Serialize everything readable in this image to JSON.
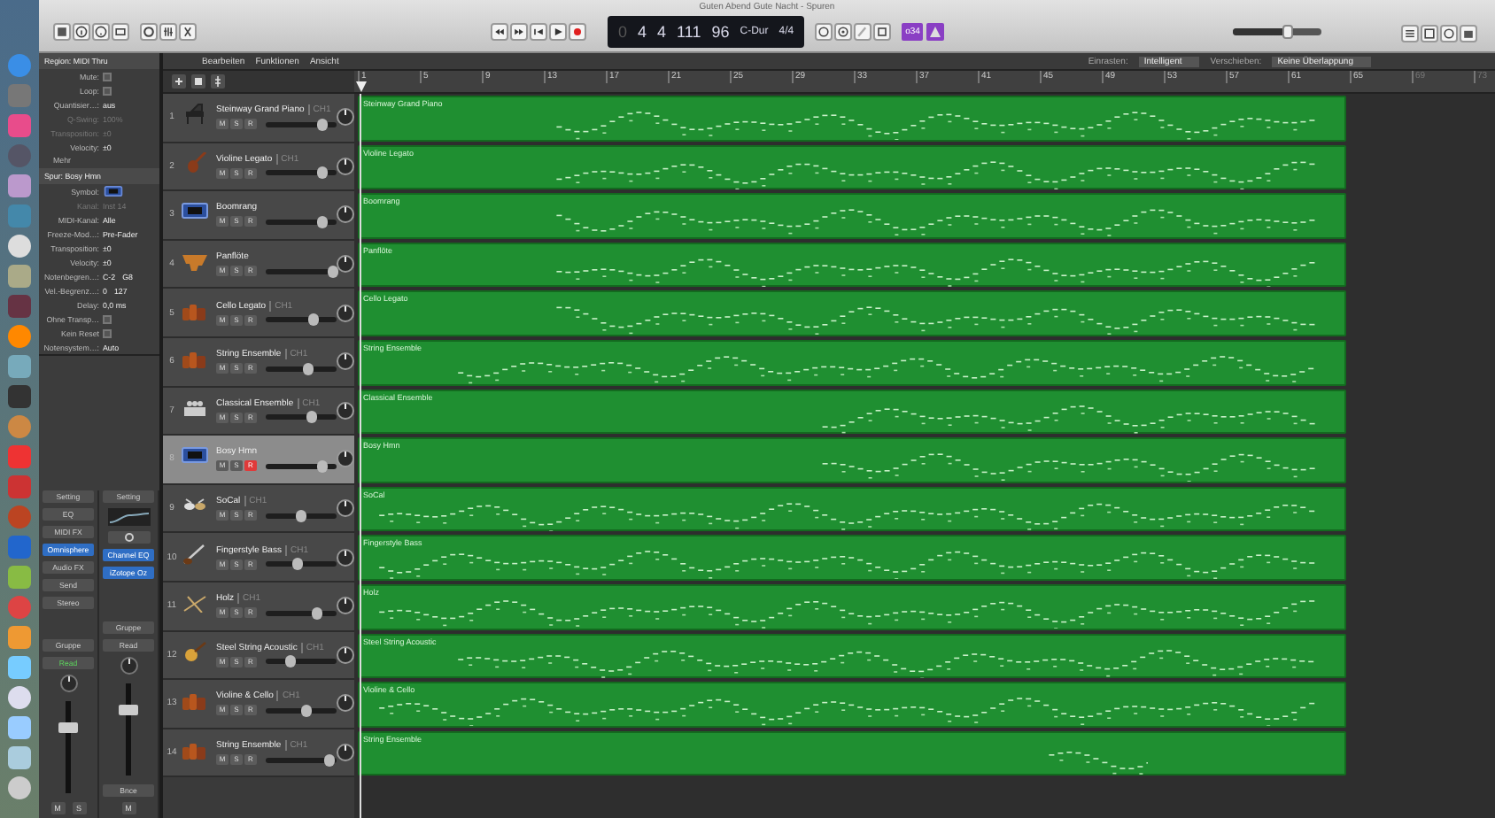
{
  "window": {
    "title": "Guten Abend Gute Nacht - Spuren"
  },
  "transport": {
    "lcd": [
      {
        "text": "0",
        "dim": true
      },
      {
        "text": "4",
        "dim": false
      },
      {
        "text": "4",
        "dim": false
      },
      {
        "text": "111",
        "dim": false
      },
      {
        "text": "96",
        "dim": false
      },
      {
        "text": "C-Dur",
        "dim": false
      },
      {
        "text": "4/4",
        "dim": false
      }
    ],
    "count_in": "o34",
    "master": {
      "level": 0.62
    }
  },
  "inspector": {
    "region": {
      "title": "Region: MIDI Thru",
      "params": [
        {
          "kind": "checkbox",
          "label": "Mute:",
          "checked": false
        },
        {
          "kind": "checkbox",
          "label": "Loop:",
          "checked": false
        },
        {
          "kind": "value",
          "label": "Quantisier…:",
          "values": [
            "aus"
          ],
          "disabled": false
        },
        {
          "kind": "value",
          "label": "Q-Swing:",
          "values": [
            "100%"
          ],
          "disabled": true
        },
        {
          "kind": "value",
          "label": "Transposition:",
          "values": [
            "±0"
          ],
          "disabled": true
        },
        {
          "kind": "value",
          "label": "Velocity:",
          "values": [
            "±0"
          ],
          "disabled": false
        },
        {
          "kind": "more",
          "label": "Mehr"
        }
      ]
    },
    "track": {
      "title": "Spur: Bosy Hmn",
      "params": [
        {
          "kind": "symbol",
          "label": "Symbol:"
        },
        {
          "kind": "value",
          "label": "Kanal:",
          "values": [
            "Inst 14"
          ],
          "disabled": true
        },
        {
          "kind": "value",
          "label": "MIDI-Kanal:",
          "values": [
            "Alle"
          ],
          "disabled": false
        },
        {
          "kind": "value",
          "label": "Freeze-Mod…:",
          "values": [
            "Pre-Fader"
          ],
          "disabled": false
        },
        {
          "kind": "value",
          "label": "Transposition:",
          "values": [
            "±0"
          ],
          "disabled": false
        },
        {
          "kind": "value",
          "label": "Velocity:",
          "values": [
            "±0"
          ],
          "disabled": false
        },
        {
          "kind": "value",
          "label": "Notenbegren…:",
          "values": [
            "C-2",
            "G8"
          ],
          "disabled": false
        },
        {
          "kind": "value",
          "label": "Vel.-Begrenz…:",
          "values": [
            "0",
            "127"
          ],
          "disabled": false
        },
        {
          "kind": "value",
          "label": "Delay:",
          "values": [
            "0,0 ms"
          ],
          "disabled": false
        },
        {
          "kind": "checkbox",
          "label": "Ohne Transp…",
          "checked": false
        },
        {
          "kind": "checkbox",
          "label": "Kein Reset",
          "checked": false
        },
        {
          "kind": "value",
          "label": "Notensystem…:",
          "values": [
            "Auto"
          ],
          "disabled": false
        }
      ]
    }
  },
  "channel_strips": [
    {
      "inserts": [
        {
          "kind": "button",
          "label": "Setting"
        },
        {
          "kind": "button",
          "label": "EQ"
        },
        {
          "kind": "button",
          "label": "MIDI FX"
        },
        {
          "kind": "plugin",
          "label": "Omnisphere"
        },
        {
          "kind": "button",
          "label": "Audio FX"
        },
        {
          "kind": "button",
          "label": "Send"
        },
        {
          "kind": "button",
          "label": "Stereo"
        }
      ],
      "group": "Gruppe",
      "automation": {
        "label": "Read",
        "on": true
      },
      "level": 0.72,
      "buttons": [
        "M",
        "S"
      ]
    },
    {
      "inserts": [
        {
          "kind": "button",
          "label": "Setting"
        },
        {
          "kind": "eq-curve"
        },
        {
          "kind": "link"
        },
        {
          "kind": "plugin",
          "label": "Channel EQ"
        },
        {
          "kind": "plugin",
          "label": "iZotope Oz"
        }
      ],
      "group": "Gruppe",
      "automation": {
        "label": "Read",
        "on": false
      },
      "level": 0.72,
      "bounce": "Bnce",
      "buttons": [
        "M"
      ]
    }
  ],
  "toolbar": {
    "menus": [
      "Bearbeiten",
      "Funktionen",
      "Ansicht"
    ],
    "snap_label": "Einrasten:",
    "snap_value": "Intelligent",
    "drag_label": "Verschieben:",
    "drag_value": "Keine Überlappung"
  },
  "ruler": [
    "1",
    "5",
    "9",
    "13",
    "17",
    "21",
    "25",
    "29",
    "33",
    "37",
    "41",
    "45",
    "49",
    "53",
    "57",
    "61",
    "65",
    "69",
    "73"
  ],
  "tracks": [
    {
      "number": "1",
      "name": "Steinway Grand Piano",
      "channel": "CH1",
      "kind": "piano",
      "buttons": [
        {
          "label": "M",
          "on": false
        },
        {
          "label": "S",
          "on": false
        },
        {
          "label": "R",
          "on": false
        }
      ],
      "selected": false,
      "level": 0.8
    },
    {
      "number": "2",
      "name": "Violine Legato",
      "channel": "CH1",
      "kind": "violin",
      "buttons": [
        {
          "label": "M",
          "on": false
        },
        {
          "label": "S",
          "on": false
        },
        {
          "label": "R",
          "on": false
        }
      ],
      "selected": false,
      "level": 0.8
    },
    {
      "number": "3",
      "name": "Boomrang",
      "kind": "synth",
      "buttons": [
        {
          "label": "M",
          "on": false
        },
        {
          "label": "S",
          "on": false
        },
        {
          "label": "R",
          "on": false
        }
      ],
      "selected": false,
      "level": 0.8
    },
    {
      "number": "4",
      "name": "Panflöte",
      "kind": "panflute",
      "buttons": [
        {
          "label": "M",
          "on": false
        },
        {
          "label": "S",
          "on": false
        },
        {
          "label": "R",
          "on": false
        }
      ],
      "selected": false,
      "level": 0.95
    },
    {
      "number": "5",
      "name": "Cello Legato",
      "channel": "CH1",
      "kind": "strings",
      "buttons": [
        {
          "label": "M",
          "on": false
        },
        {
          "label": "S",
          "on": false
        },
        {
          "label": "R",
          "on": false
        }
      ],
      "selected": false,
      "level": 0.68
    },
    {
      "number": "6",
      "name": "String Ensemble",
      "channel": "CH1",
      "kind": "strings",
      "buttons": [
        {
          "label": "M",
          "on": false
        },
        {
          "label": "S",
          "on": false
        },
        {
          "label": "R",
          "on": false
        }
      ],
      "selected": false,
      "level": 0.6
    },
    {
      "number": "7",
      "name": "Classical Ensemble",
      "channel": "CH1",
      "kind": "ensemble",
      "buttons": [
        {
          "label": "M",
          "on": false
        },
        {
          "label": "S",
          "on": false
        },
        {
          "label": "R",
          "on": false
        }
      ],
      "selected": false,
      "level": 0.65
    },
    {
      "number": "8",
      "name": "Bosy Hmn",
      "kind": "synth",
      "buttons": [
        {
          "label": "M",
          "on": false
        },
        {
          "label": "S",
          "on": false
        },
        {
          "label": "R",
          "on": true
        }
      ],
      "selected": true,
      "level": 0.8
    },
    {
      "number": "9",
      "name": "SoCal",
      "channel": "CH1",
      "kind": "drums",
      "buttons": [
        {
          "label": "M",
          "on": false
        },
        {
          "label": "S",
          "on": false
        },
        {
          "label": "R",
          "on": false
        }
      ],
      "selected": false,
      "level": 0.5
    },
    {
      "number": "10",
      "name": "Fingerstyle Bass",
      "channel": "CH1",
      "kind": "bass",
      "buttons": [
        {
          "label": "M",
          "on": false
        },
        {
          "label": "S",
          "on": false
        },
        {
          "label": "R",
          "on": false
        }
      ],
      "selected": false,
      "level": 0.45
    },
    {
      "number": "11",
      "name": "Holz",
      "channel": "CH1",
      "kind": "sticks",
      "buttons": [
        {
          "label": "M",
          "on": false
        },
        {
          "label": "S",
          "on": false
        },
        {
          "label": "R",
          "on": false
        }
      ],
      "selected": false,
      "level": 0.72
    },
    {
      "number": "12",
      "name": "Steel String Acoustic",
      "channel": "CH1",
      "kind": "guitar",
      "buttons": [
        {
          "label": "M",
          "on": false
        },
        {
          "label": "S",
          "on": false
        },
        {
          "label": "R",
          "on": false
        }
      ],
      "selected": false,
      "level": 0.35
    },
    {
      "number": "13",
      "name": "Violine & Cello",
      "channel": "CH1",
      "kind": "strings",
      "buttons": [
        {
          "label": "M",
          "on": false
        },
        {
          "label": "S",
          "on": false
        },
        {
          "label": "R",
          "on": false
        }
      ],
      "selected": false,
      "level": 0.58
    },
    {
      "number": "14",
      "name": "String Ensemble",
      "channel": "CH1",
      "kind": "strings",
      "buttons": [
        {
          "label": "M",
          "on": false
        },
        {
          "label": "S",
          "on": false
        },
        {
          "label": "R",
          "on": false
        }
      ],
      "selected": false,
      "level": 0.9
    }
  ],
  "regions": [
    {
      "name": "Steinway Grand Piano"
    },
    {
      "name": "Violine Legato"
    },
    {
      "name": "Boomrang"
    },
    {
      "name": "Panflöte"
    },
    {
      "name": "Cello Legato"
    },
    {
      "name": "String Ensemble"
    },
    {
      "name": "Classical Ensemble"
    },
    {
      "name": "Bosy Hmn"
    },
    {
      "name": "SoCal"
    },
    {
      "name": "Fingerstyle Bass"
    },
    {
      "name": "Holz"
    },
    {
      "name": "Steel String Acoustic"
    },
    {
      "name": "Violine & Cello"
    },
    {
      "name": "String Ensemble"
    }
  ]
}
